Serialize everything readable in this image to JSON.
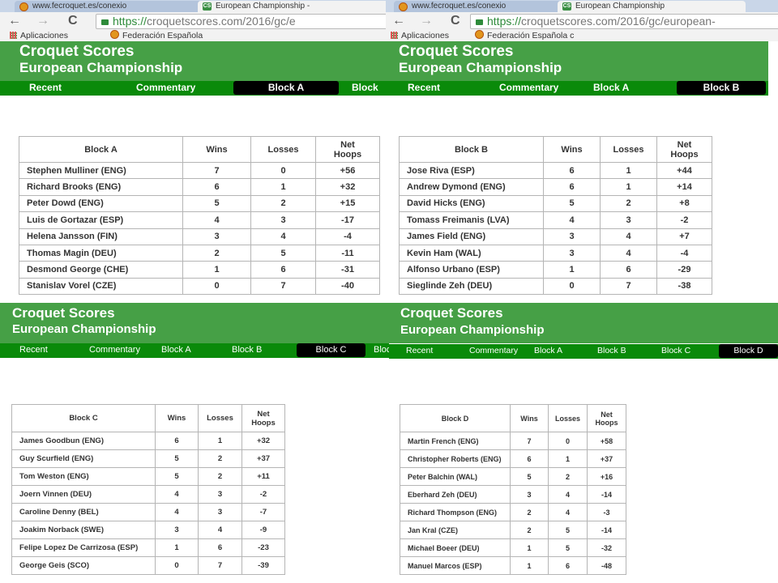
{
  "browser": {
    "tabs": {
      "fecroquet": "www.fecroquet.es/conexio",
      "croquet_scores": "European Championship",
      "croquet_scores_left": "European Championship -",
      "favicon_text": "CS"
    },
    "nav_icons": {
      "back": "←",
      "forward": "→",
      "reload": "C"
    },
    "address": {
      "https": "https://",
      "left_rest": "croquetscores.com/2016/gc/e",
      "right_rest": "croquetscores.com/2016/gc/european-"
    },
    "bookmarks": {
      "apps": "Aplicaciones",
      "federacion": "Federación Española",
      "federacion_short": "Federación Española c"
    }
  },
  "site": {
    "title": "Croquet Scores",
    "subtitle": "European Championship",
    "brand_green": "#46a046",
    "nav_green": "#0a8a0a",
    "nav": {
      "recent": "Recent",
      "commentary": "Commentary",
      "block_a": "Block A",
      "block_b": "Block B",
      "block_c": "Block C",
      "block_d": "Block D",
      "block_cut": "Block",
      "block_cut2": "Bloc"
    }
  },
  "headers": {
    "wins": "Wins",
    "losses": "Losses",
    "net_l1": "Net",
    "net_l2": "Hoops"
  },
  "blocks": {
    "a": {
      "title": "Block A",
      "rows": [
        [
          "Stephen Mulliner (ENG)",
          "7",
          "0",
          "+56"
        ],
        [
          "Richard Brooks (ENG)",
          "6",
          "1",
          "+32"
        ],
        [
          "Peter Dowd (ENG)",
          "5",
          "2",
          "+15"
        ],
        [
          "Luis de Gortazar (ESP)",
          "4",
          "3",
          "-17"
        ],
        [
          "Helena Jansson (FIN)",
          "3",
          "4",
          "-4"
        ],
        [
          "Thomas Magin (DEU)",
          "2",
          "5",
          "-11"
        ],
        [
          "Desmond George (CHE)",
          "1",
          "6",
          "-31"
        ],
        [
          "Stanislav Vorel (CZE)",
          "0",
          "7",
          "-40"
        ]
      ]
    },
    "b": {
      "title": "Block B",
      "rows": [
        [
          "Jose Riva (ESP)",
          "6",
          "1",
          "+44"
        ],
        [
          "Andrew Dymond (ENG)",
          "6",
          "1",
          "+14"
        ],
        [
          "David Hicks (ENG)",
          "5",
          "2",
          "+8"
        ],
        [
          "Tomass Freimanis (LVA)",
          "4",
          "3",
          "-2"
        ],
        [
          "James Field (ENG)",
          "3",
          "4",
          "+7"
        ],
        [
          "Kevin Ham (WAL)",
          "3",
          "4",
          "-4"
        ],
        [
          "Alfonso Urbano (ESP)",
          "1",
          "6",
          "-29"
        ],
        [
          "Sieglinde Zeh (DEU)",
          "0",
          "7",
          "-38"
        ]
      ]
    },
    "c": {
      "title": "Block C",
      "rows": [
        [
          "James Goodbun (ENG)",
          "6",
          "1",
          "+32"
        ],
        [
          "Guy Scurfield (ENG)",
          "5",
          "2",
          "+37"
        ],
        [
          "Tom Weston (ENG)",
          "5",
          "2",
          "+11"
        ],
        [
          "Joern Vinnen (DEU)",
          "4",
          "3",
          "-2"
        ],
        [
          "Caroline Denny (BEL)",
          "4",
          "3",
          "-7"
        ],
        [
          "Joakim Norback (SWE)",
          "3",
          "4",
          "-9"
        ],
        [
          "Felipe Lopez De Carrizosa (ESP)",
          "1",
          "6",
          "-23"
        ],
        [
          "George Geis (SCO)",
          "0",
          "7",
          "-39"
        ]
      ]
    },
    "d": {
      "title": "Block D",
      "rows": [
        [
          "Martin French (ENG)",
          "7",
          "0",
          "+58"
        ],
        [
          "Christopher Roberts (ENG)",
          "6",
          "1",
          "+37"
        ],
        [
          "Peter Balchin (WAL)",
          "5",
          "2",
          "+16"
        ],
        [
          "Eberhard Zeh (DEU)",
          "3",
          "4",
          "-14"
        ],
        [
          "Richard Thompson (ENG)",
          "2",
          "4",
          "-3"
        ],
        [
          "Jan Kral (CZE)",
          "2",
          "5",
          "-14"
        ],
        [
          "Michael Boeer (DEU)",
          "1",
          "5",
          "-32"
        ],
        [
          "Manuel Marcos (ESP)",
          "1",
          "6",
          "-48"
        ]
      ]
    }
  }
}
